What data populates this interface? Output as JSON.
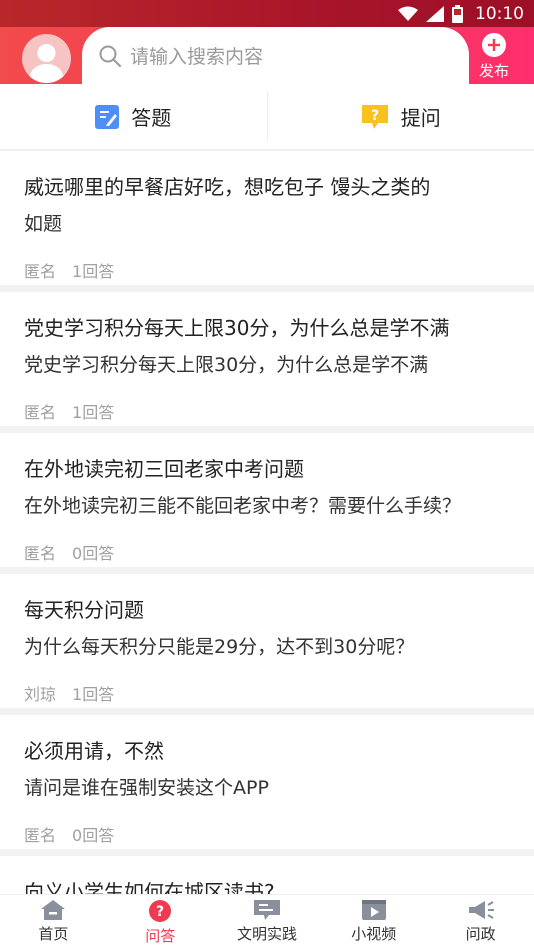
{
  "status_bar": {
    "time": "10:10",
    "icons": [
      "wifi-icon",
      "signal-icon",
      "battery-icon"
    ]
  },
  "header": {
    "search_placeholder": "请输入搜索内容",
    "publish_label": "发布"
  },
  "tabs": [
    {
      "label": "答题",
      "icon": "edit-icon",
      "color": "#4f8ef7"
    },
    {
      "label": "提问",
      "icon": "question-bubble-icon",
      "color": "#f7c21f"
    }
  ],
  "feed": [
    {
      "title": "威远哪里的早餐店好吃，想吃包子 馒头之类的",
      "desc": "如题",
      "author": "匿名",
      "answers": "1回答"
    },
    {
      "title": "党史学习积分每天上限30分，为什么总是学不满",
      "desc": "党史学习积分每天上限30分，为什么总是学不满",
      "author": "匿名",
      "answers": "1回答"
    },
    {
      "title": "在外地读完初三回老家中考问题",
      "desc": "在外地读完初三能不能回老家中考？需要什么手续？",
      "author": "匿名",
      "answers": "0回答"
    },
    {
      "title": "每天积分问题",
      "desc": "为什么每天积分只能是29分，达不到30分呢？",
      "author": "刘琼",
      "answers": "1回答"
    },
    {
      "title": "必须用请，不然",
      "desc": "请问是谁在强制安装这个APP",
      "author": "匿名",
      "answers": "0回答"
    },
    {
      "title": "向义小学生如何在城区读书?",
      "desc": "",
      "author": "",
      "answers": ""
    }
  ],
  "bottom_nav": [
    {
      "label": "首页",
      "icon": "home-icon"
    },
    {
      "label": "问答",
      "icon": "qa-icon",
      "active": true
    },
    {
      "label": "文明实践",
      "icon": "practice-icon"
    },
    {
      "label": "小视频",
      "icon": "video-icon"
    },
    {
      "label": "问政",
      "icon": "megaphone-icon"
    }
  ],
  "colors": {
    "accent": "#f03a4f",
    "header_start": "#f24b4b",
    "header_end": "#ff2e6e"
  }
}
